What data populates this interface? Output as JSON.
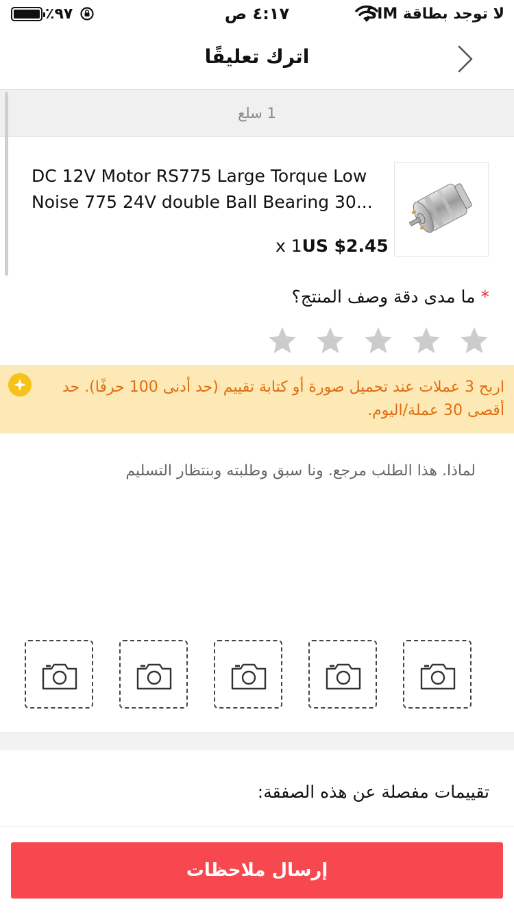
{
  "status_bar": {
    "battery_text": "٪٩٧",
    "time": "٤:١٧ ص",
    "carrier": "لا توجد بطاقة SIM"
  },
  "nav": {
    "title": "اترك تعليقًا"
  },
  "order": {
    "item_count": "1 سلع"
  },
  "product": {
    "title_line1": "DC 12V Motor RS775 Large Torque Low",
    "title_line2": "Noise 775 24V double Ball Bearing 30...",
    "quantity": "x 1",
    "price": "US $2.45"
  },
  "rating": {
    "required_mark": "*",
    "question": "ما مدى دقة وصف المنتج؟",
    "stars_total": 5,
    "stars_selected": 0,
    "star_color": "#cccccc"
  },
  "banner": {
    "text": "اربح 3 عملات عند تحميل صورة أو كتابة تقييم (حد أدنى 100 حرفًا). حد أقصى 30 عملة/اليوم.",
    "bg_color": "#fde9b6",
    "text_color": "#e06c12",
    "icon": "coin-icon"
  },
  "review": {
    "text": "لماذا. هذا الطلب مرجع.  ونا سبق وطلبته وبنتظار التسليم"
  },
  "photos": {
    "slots": 5,
    "icon": "camera-icon"
  },
  "details": {
    "label": "تقييمات مفصلة عن هذه الصفقة:"
  },
  "submit": {
    "label": "إرسال ملاحظات",
    "color": "#f7474f"
  }
}
